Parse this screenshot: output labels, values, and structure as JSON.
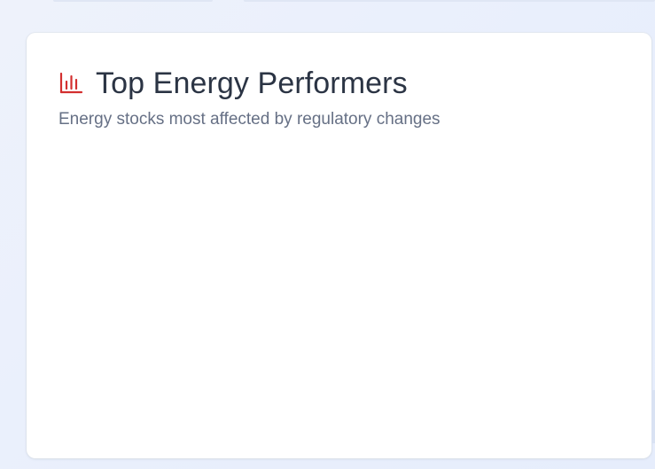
{
  "card": {
    "title": "Top Energy Performers",
    "subtitle": "Energy stocks most affected by regulatory changes",
    "icon": "bar-chart-icon",
    "icon_color": "#d32f2f"
  },
  "colors": {
    "background": "#e9effc",
    "card_background": "#ffffff",
    "title_text": "#2b3444",
    "subtitle_text": "#667085"
  }
}
